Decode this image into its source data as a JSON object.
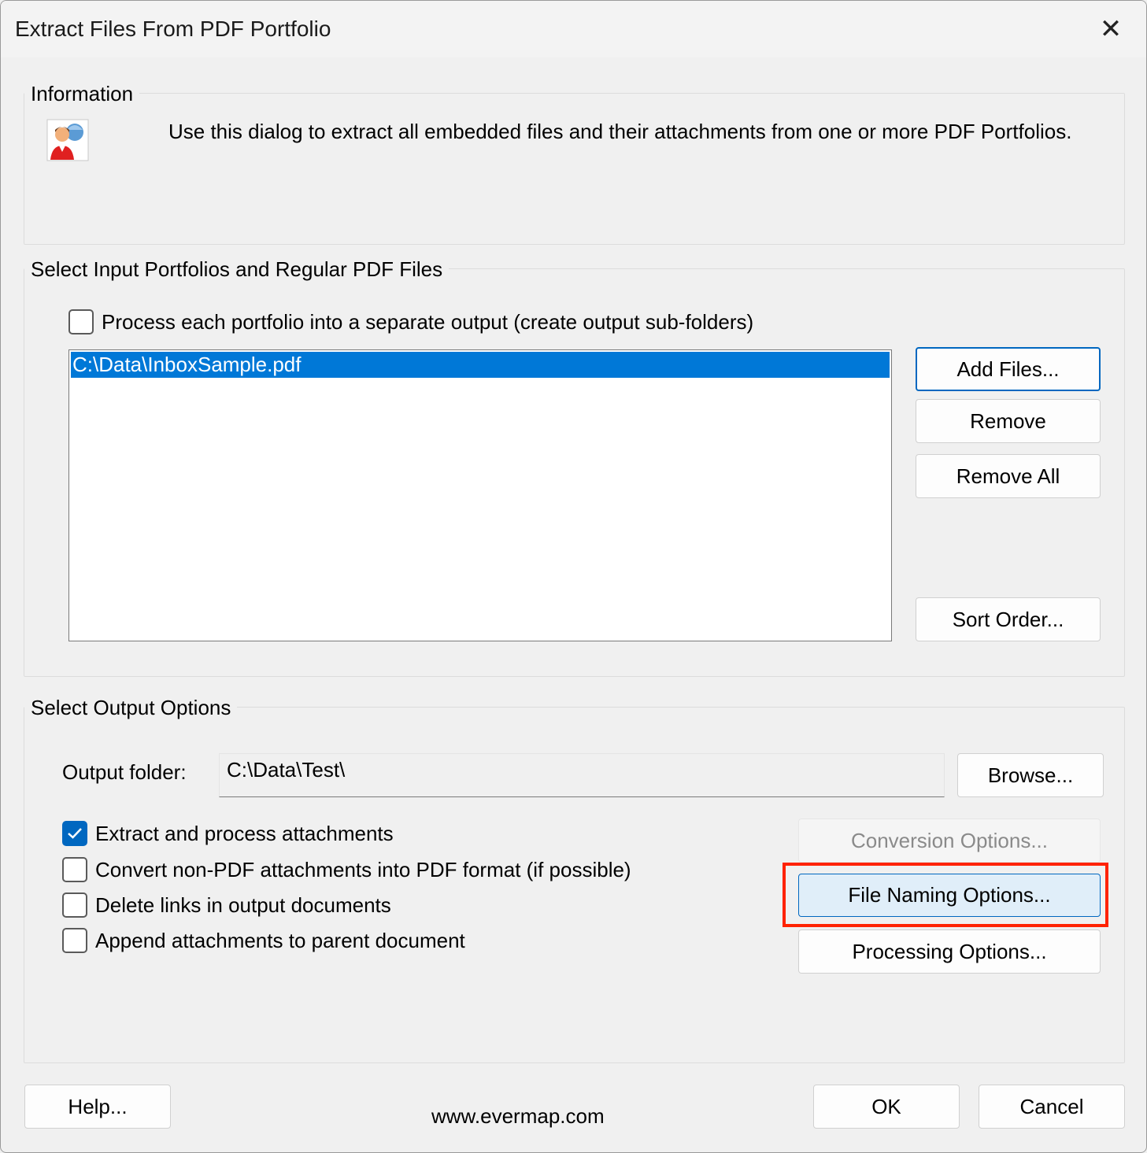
{
  "window": {
    "title": "Extract Files From PDF Portfolio",
    "close_glyph": "✕"
  },
  "information": {
    "label": "Information",
    "text": "Use this dialog to extract all embedded files and their attachments from one or more PDF Portfolios."
  },
  "input": {
    "label": "Select Input Portfolios and Regular PDF Files",
    "separate_output_label": "Process each portfolio into a separate output (create output sub-folders)",
    "separate_output_checked": false,
    "files": [
      "C:\\Data\\InboxSample.pdf"
    ],
    "add_files_label": "Add Files...",
    "remove_label": "Remove",
    "remove_all_label": "Remove All",
    "sort_order_label": "Sort Order..."
  },
  "output": {
    "label": "Select Output Options",
    "folder_label": "Output folder:",
    "folder_value": "C:\\Data\\Test\\",
    "browse_label": "Browse...",
    "options": [
      {
        "label": "Extract and process attachments",
        "checked": true
      },
      {
        "label": "Convert non-PDF attachments into PDF format (if possible)",
        "checked": false
      },
      {
        "label": "Delete links in output documents",
        "checked": false
      },
      {
        "label": "Append attachments to parent document",
        "checked": false
      }
    ],
    "conversion_options_label": "Conversion Options...",
    "file_naming_options_label": "File Naming Options...",
    "processing_options_label": "Processing Options..."
  },
  "footer": {
    "help_label": "Help...",
    "url": "www.evermap.com",
    "ok_label": "OK",
    "cancel_label": "Cancel"
  },
  "colors": {
    "selection": "#0078d7",
    "checkbox_checked": "#0067c0",
    "highlight": "#ff2200"
  }
}
